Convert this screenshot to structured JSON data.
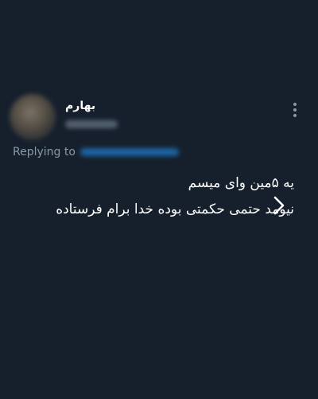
{
  "tweet": {
    "display_name": "بهارم",
    "replying_to_label": "Replying to",
    "text_lines": [
      "یه ۵مین وای میسم",
      "نیومد حتمی حکمتی بوده خدا برام فرستاده"
    ]
  },
  "icons": {
    "more": "more-vertical-icon",
    "next": "chevron-right-icon"
  },
  "colors": {
    "background": "#16202c",
    "secondary_text": "#8899a6",
    "link": "#1d9bf0"
  }
}
